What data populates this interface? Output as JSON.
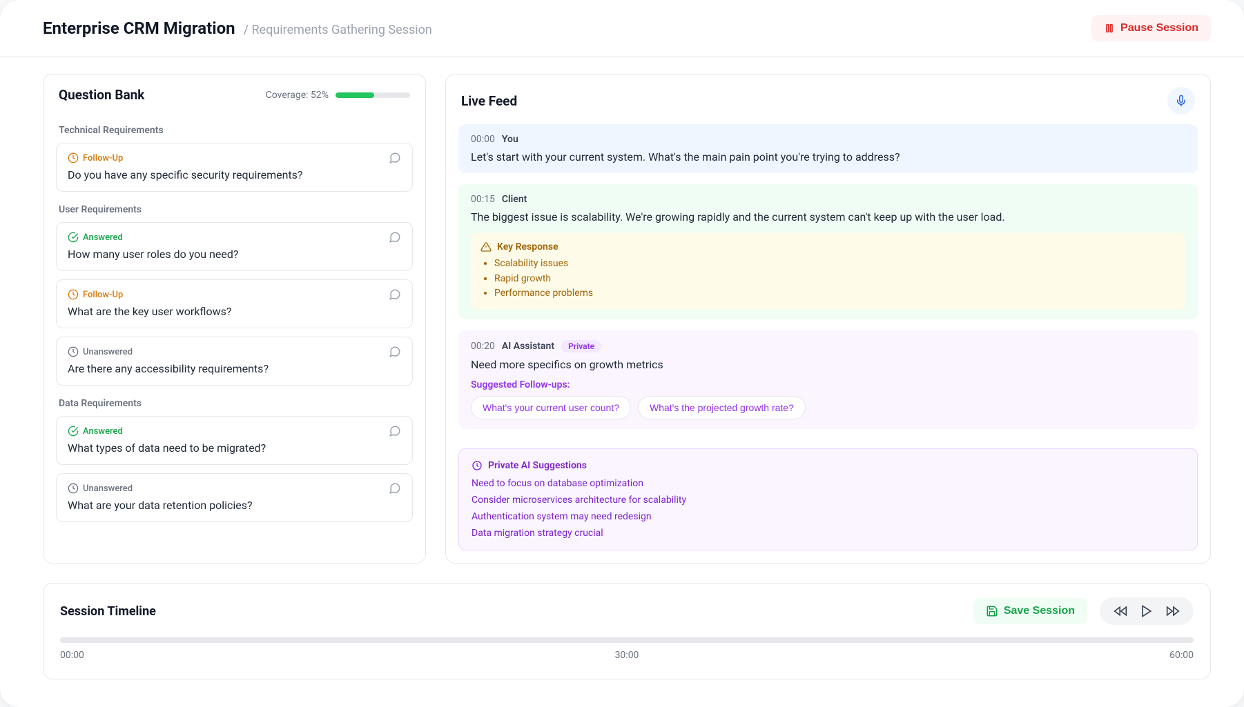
{
  "header": {
    "title": "Enterprise CRM Migration",
    "breadcrumb": "/ Requirements Gathering Session",
    "pause_label": "Pause Session"
  },
  "question_bank": {
    "title": "Question Bank",
    "coverage_label": "Coverage: 52%",
    "coverage_pct": 52,
    "sections": [
      {
        "label": "Technical Requirements",
        "items": [
          {
            "status": "followup",
            "status_label": "Follow-Up",
            "text": "Do you have any specific security requirements?"
          }
        ]
      },
      {
        "label": "User Requirements",
        "items": [
          {
            "status": "answered",
            "status_label": "Answered",
            "text": "How many user roles do you need?"
          },
          {
            "status": "followup",
            "status_label": "Follow-Up",
            "text": "What are the key user workflows?"
          },
          {
            "status": "unanswered",
            "status_label": "Unanswered",
            "text": "Are there any accessibility requirements?"
          }
        ]
      },
      {
        "label": "Data Requirements",
        "items": [
          {
            "status": "answered",
            "status_label": "Answered",
            "text": "What types of data need to be migrated?"
          },
          {
            "status": "unanswered",
            "status_label": "Unanswered",
            "text": "What are your data retention policies?"
          }
        ]
      }
    ]
  },
  "live_feed": {
    "title": "Live Feed",
    "messages": [
      {
        "type": "you",
        "time": "00:00",
        "speaker": "You",
        "text": "Let's start with your current system. What's the main pain point you're trying to address?"
      },
      {
        "type": "client",
        "time": "00:15",
        "speaker": "Client",
        "text": "The biggest issue is scalability. We're growing rapidly and the current system can't keep up with the user load.",
        "key_response": {
          "label": "Key Response",
          "bullets": [
            "Scalability issues",
            "Rapid growth",
            "Performance problems"
          ]
        }
      },
      {
        "type": "ai",
        "time": "00:20",
        "speaker": "AI Assistant",
        "private_label": "Private",
        "text": "Need more specifics on growth metrics",
        "followups_label": "Suggested Follow-ups:",
        "followups": [
          "What's your current user count?",
          "What's the projected growth rate?"
        ]
      }
    ],
    "suggestions": {
      "label": "Private AI Suggestions",
      "items": [
        "Need to focus on database optimization",
        "Consider microservices architecture for scalability",
        "Authentication system may need redesign",
        "Data migration strategy crucial"
      ]
    }
  },
  "timeline": {
    "title": "Session Timeline",
    "save_label": "Save Session",
    "labels": [
      "00:00",
      "30:00",
      "60:00"
    ]
  }
}
